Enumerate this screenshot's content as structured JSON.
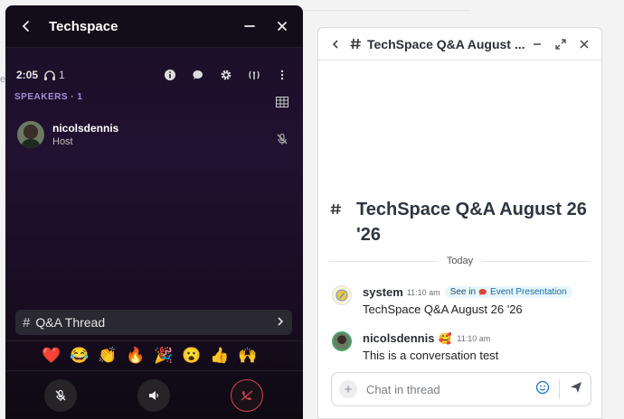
{
  "left_panel": {
    "title": "Techspace",
    "elapsed": "2:05",
    "listeners": "1",
    "speakers_label": "SPEAKERS · 1",
    "speaker": {
      "name": "nicolsdennis",
      "role": "Host"
    },
    "thread_label": "Q&A Thread",
    "reactions": [
      "❤️",
      "😂",
      "👏",
      "🔥",
      "🎉",
      "😮",
      "👍",
      "🙌"
    ]
  },
  "right_panel": {
    "header_title": "TechSpace Q&A August ...",
    "big_title": "TechSpace Q&A August 26 '26",
    "date_divider": "Today",
    "messages": [
      {
        "author": "system",
        "time": "11:10 am",
        "badge_prefix": "See in",
        "badge_link": "Event Presentation",
        "text": "TechSpace Q&A August 26 '26"
      },
      {
        "author": "nicolsdennis",
        "author_emoji": "🥰",
        "time": "11:10 am",
        "text": "This is a conversation test"
      }
    ],
    "composer_placeholder": "Chat in thread"
  },
  "colors": {
    "accent_purple": "#a68dd8",
    "leave_red": "#d14552",
    "online_green": "#4aa36a"
  }
}
